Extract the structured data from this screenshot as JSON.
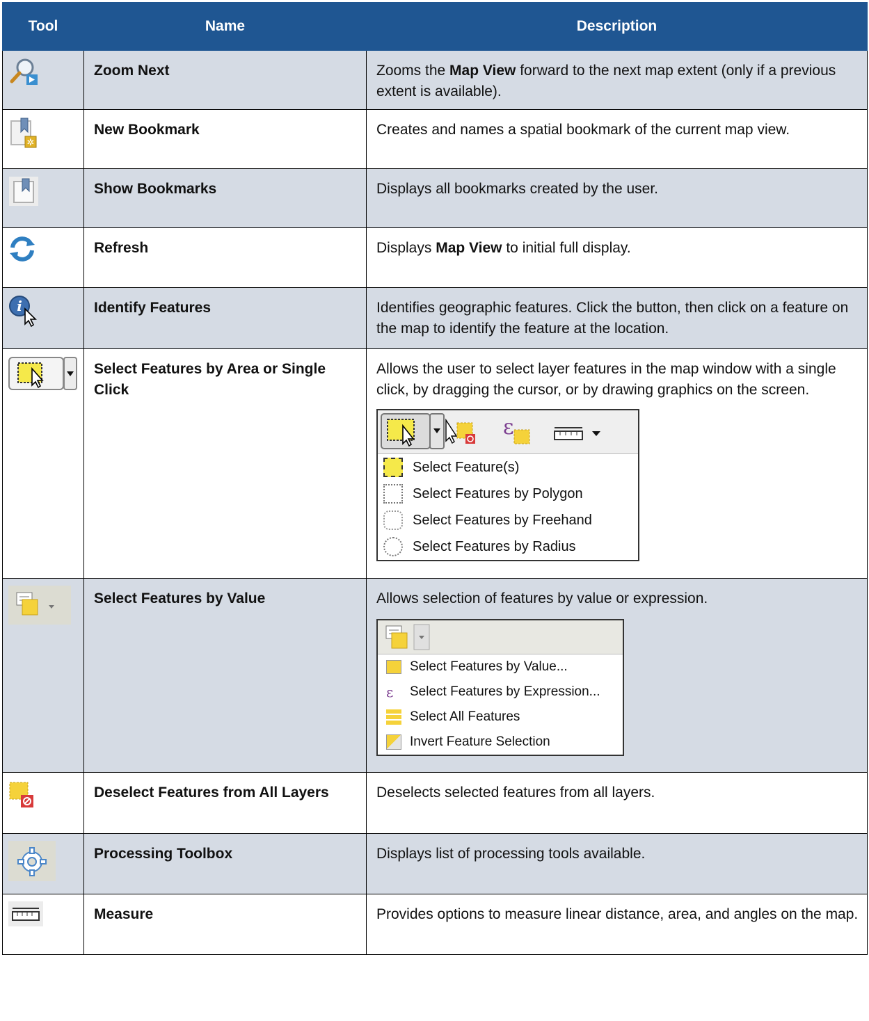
{
  "header": {
    "tool": "Tool",
    "name": "Name",
    "description": "Description"
  },
  "rows": [
    {
      "name": "Zoom Next",
      "desc_pre": "Zooms the ",
      "desc_bold": "Map View",
      "desc_post": " forward to the next map extent (only if a previous extent is available).",
      "icon": "zoom-next-icon"
    },
    {
      "name": "New Bookmark",
      "desc": "Creates and names a spatial bookmark of the current map view.",
      "icon": "new-bookmark-icon"
    },
    {
      "name": "Show Bookmarks",
      "desc": "Displays all bookmarks created by the user.",
      "icon": "show-bookmarks-icon"
    },
    {
      "name": "Refresh",
      "desc_pre": "Displays ",
      "desc_bold": "Map View",
      "desc_post": " to initial full display.",
      "icon": "refresh-icon"
    },
    {
      "name": "Identify Features",
      "desc": "Identifies geographic features. Click the button, then click on a feature on the map to identify the feature at the location.",
      "icon": "identify-features-icon"
    },
    {
      "name": "Select Features by Area or Single Click",
      "desc": "Allows the user to select layer features in the map window with a single click, by dragging the cursor, or by drawing graphics on the screen.",
      "icon": "select-features-icon",
      "menu": [
        "Select Feature(s)",
        "Select Features by Polygon",
        "Select Features by Freehand",
        "Select Features by Radius"
      ]
    },
    {
      "name": "Select Features by Value",
      "desc": "Allows selection of features by value or expression.",
      "icon": "select-by-value-icon",
      "menu": [
        "Select Features by Value...",
        "Select Features by Expression...",
        "Select All Features",
        "Invert Feature Selection"
      ]
    },
    {
      "name": "Deselect Features from All Layers",
      "desc": "Deselects selected features from all layers.",
      "icon": "deselect-features-icon"
    },
    {
      "name": "Processing Toolbox",
      "desc": "Displays list of processing tools available.",
      "icon": "processing-toolbox-icon"
    },
    {
      "name": "Measure",
      "desc": "Provides options to measure linear distance, area, and angles on the map.",
      "icon": "measure-icon"
    }
  ]
}
